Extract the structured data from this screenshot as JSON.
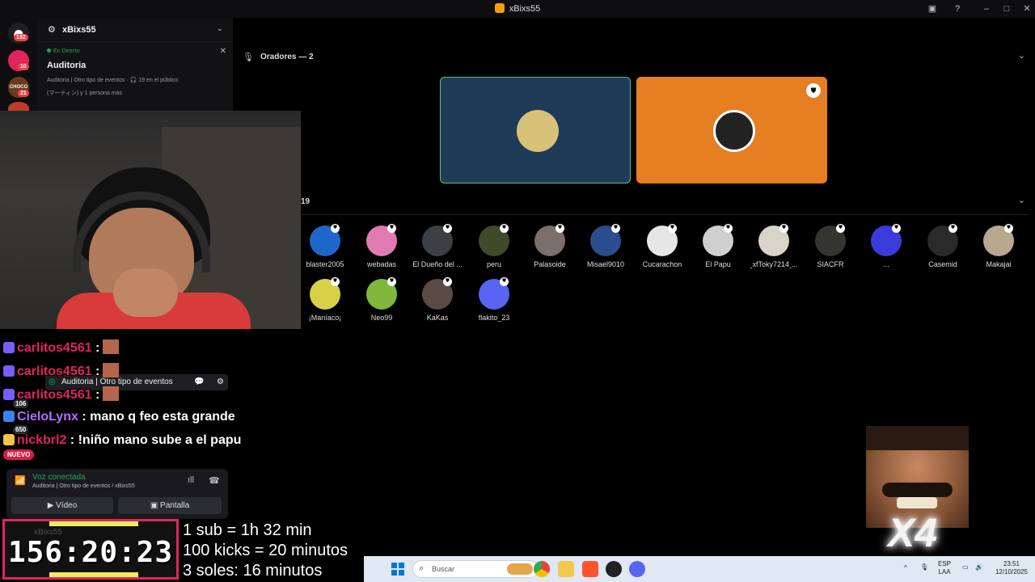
{
  "window": {
    "title": "xBixs55"
  },
  "rail": {
    "home_badge": "132",
    "servers": [
      {
        "badge": "10"
      },
      {
        "label": "CHOCO",
        "badge": "21"
      }
    ]
  },
  "server_header": {
    "name": "xBixs55"
  },
  "event": {
    "live": "En Directo",
    "title": "Auditoria",
    "meta": "Auditoria | Otro tipo de eventos · 🎧 19 en el público",
    "users": "(マーティン) y 1 persona más"
  },
  "stage": {
    "speakers_label": "Oradores — 2",
    "audience_count": "19",
    "speakers": [
      {
        "color": "#1f3b57",
        "border": "#5fc36a",
        "avatar": "#d8c27a"
      },
      {
        "color": "#e67e22",
        "border": "#e67e22",
        "avatar": "#222222"
      }
    ],
    "audience": [
      {
        "name": "blaster2005",
        "color": "#1e66c9"
      },
      {
        "name": "webadas",
        "color": "#e07ab0"
      },
      {
        "name": "El Dueño del ...",
        "color": "#3c3f45"
      },
      {
        "name": "peru",
        "color": "#3f4a2a"
      },
      {
        "name": "Palasoide",
        "color": "#7a6f6a"
      },
      {
        "name": "Misael9010",
        "color": "#2b4c8f"
      },
      {
        "name": "Cucarachon",
        "color": "#e6e6e6"
      },
      {
        "name": "El Papu",
        "color": "#cfcfcf"
      },
      {
        "name": "ꞈxfToky7214ꞈ...",
        "color": "#d9d4c7"
      },
      {
        "name": "SIACFR",
        "color": "#34352f"
      },
      {
        "name": "...",
        "color": "#3b3bdc"
      },
      {
        "name": "Casemid",
        "color": "#2a2a2a"
      },
      {
        "name": "Makajai",
        "color": "#b9a890"
      },
      {
        "name": "¡Maníaco¡",
        "color": "#d9d04a"
      },
      {
        "name": "Neo99",
        "color": "#7fb83a"
      },
      {
        "name": "KaKas",
        "color": "#5a4a44"
      },
      {
        "name": "flakito_23",
        "color": "#5865f2"
      }
    ]
  },
  "chat": [
    {
      "user": "carlitos4561",
      "sep": " :",
      "msg": "",
      "color": "#e0245e"
    },
    {
      "user": "carlitos4561",
      "sep": " :",
      "msg": "",
      "color": "#e0245e"
    },
    {
      "user": "carlitos4561",
      "sep": " :",
      "msg": "",
      "color": "#e0245e"
    },
    {
      "user": "CieloLynx",
      "sep": " :",
      "msg": " mano q feo esta grande",
      "color": "#b26cff"
    },
    {
      "user": "nickbrl2",
      "sep": " :",
      "msg": " !niño mano sube a el papu",
      "color": "#e0245e"
    }
  ],
  "chat_badges": [
    "106",
    "650"
  ],
  "nuevo": "NUEVO",
  "mini_event": {
    "label": "Auditoria | Otro tipo de eventos"
  },
  "voice": {
    "status": "Voz conectada",
    "sub": "Auditoria | Otro tipo de eventos / xBixs55",
    "video": "Vídeo",
    "screen": "Pantalla"
  },
  "timer": {
    "value": "156:20:23",
    "user": "xBixs55"
  },
  "rules": [
    "1 sub = 1h 32 min",
    "100 kicks = 20 minutos",
    "3 soles: 16 minutos"
  ],
  "meme": {
    "label": "X4"
  },
  "taskbar": {
    "search_placeholder": "Buscar",
    "lang": "ESP",
    "region": "LAA",
    "time": "23:51",
    "date": "12/10/2025"
  }
}
